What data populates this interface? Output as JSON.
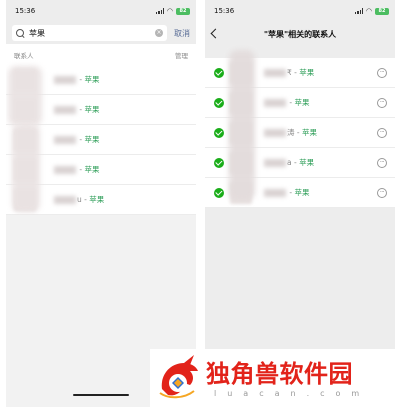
{
  "left": {
    "status_time": "15:36",
    "battery": "82",
    "search_value": "苹果",
    "cancel_label": "取消",
    "section_label": "联系人",
    "manage_label": "管理",
    "contacts": [
      {
        "name": "",
        "tag": "苹果"
      },
      {
        "name": "",
        "tag": "苹果"
      },
      {
        "name": "",
        "tag": "苹果"
      },
      {
        "name": "",
        "tag": "苹果"
      },
      {
        "name": "u",
        "tag": "苹果"
      }
    ]
  },
  "right": {
    "status_time": "15:36",
    "battery": "82",
    "title": "\"苹果\"相关的联系人",
    "contacts": [
      {
        "name": "₹",
        "tag": "苹果",
        "checked": true
      },
      {
        "name": "",
        "tag": "苹果",
        "checked": true
      },
      {
        "name": "涛",
        "tag": "苹果",
        "checked": true
      },
      {
        "name": "a",
        "tag": "苹果",
        "checked": true
      },
      {
        "name": "",
        "tag": "苹果",
        "checked": true
      }
    ],
    "more_glyph": "···"
  },
  "watermark": {
    "title": "独角兽软件园",
    "subtitle": "luacan.com"
  },
  "colors": {
    "accent_green": "#1aad19",
    "tag_green": "#2e9e58",
    "link_blue": "#576b95",
    "watermark_red": "#e2231a"
  },
  "icons": [
    "search-icon",
    "clear-icon",
    "back-icon",
    "check-icon",
    "more-icon",
    "signal-icon",
    "wifi-icon",
    "battery-icon",
    "unicorn-logo"
  ]
}
